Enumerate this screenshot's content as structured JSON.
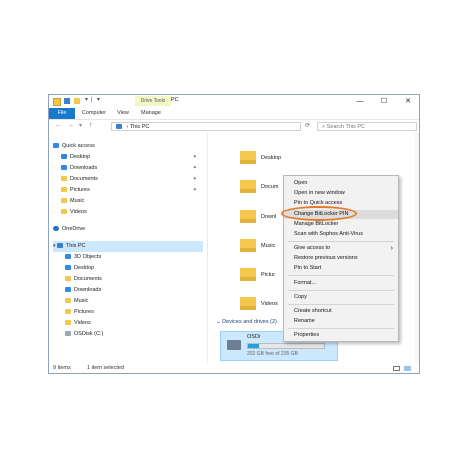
{
  "window": {
    "title": "This PC",
    "contextual_tab": "Drive Tools",
    "controls": {
      "minimize": "—",
      "maximize": "☐",
      "close": "✕"
    }
  },
  "ribbon": {
    "tabs": [
      "File",
      "Computer",
      "View",
      "Manage"
    ]
  },
  "address": {
    "path": "This PC",
    "search_placeholder": "Search This PC"
  },
  "nav": {
    "quick_access": "Quick access",
    "quick_items": [
      "Desktop",
      "Downloads",
      "Documents",
      "Pictures",
      "Music",
      "Videos"
    ],
    "onedrive": "OneDrive",
    "this_pc": "This PC",
    "pc_items": [
      "3D Objects",
      "Desktop",
      "Documents",
      "Downloads",
      "Music",
      "Pictures",
      "Videos",
      "OSDisk (C:)"
    ]
  },
  "content": {
    "folders": [
      "Desktop",
      "Docum",
      "Downl",
      "Music",
      "Pictur",
      "Videos"
    ],
    "devices_header": "Devices and drives (2)",
    "drive_name": "OSDi",
    "drive_free": "202 GB free of 235 GB",
    "drive_fill": 0.14
  },
  "status": {
    "items": "9 items",
    "selected": "1 item selected"
  },
  "context_menu": {
    "items": [
      "Open",
      "Open in new window",
      "Pin to Quick access",
      "Change BitLocker PIN",
      "Manage BitLocker",
      "Scan with Sophos Anti-Virus",
      "Give access to",
      "Restore previous versions",
      "Pin to Start",
      "Format...",
      "Copy",
      "Create shortcut",
      "Rename",
      "Properties"
    ],
    "submenu_arrow": "›"
  },
  "colors": {
    "accent": "#1979ca",
    "highlight_ring": "#e8792a",
    "selection": "#cce8ff"
  }
}
